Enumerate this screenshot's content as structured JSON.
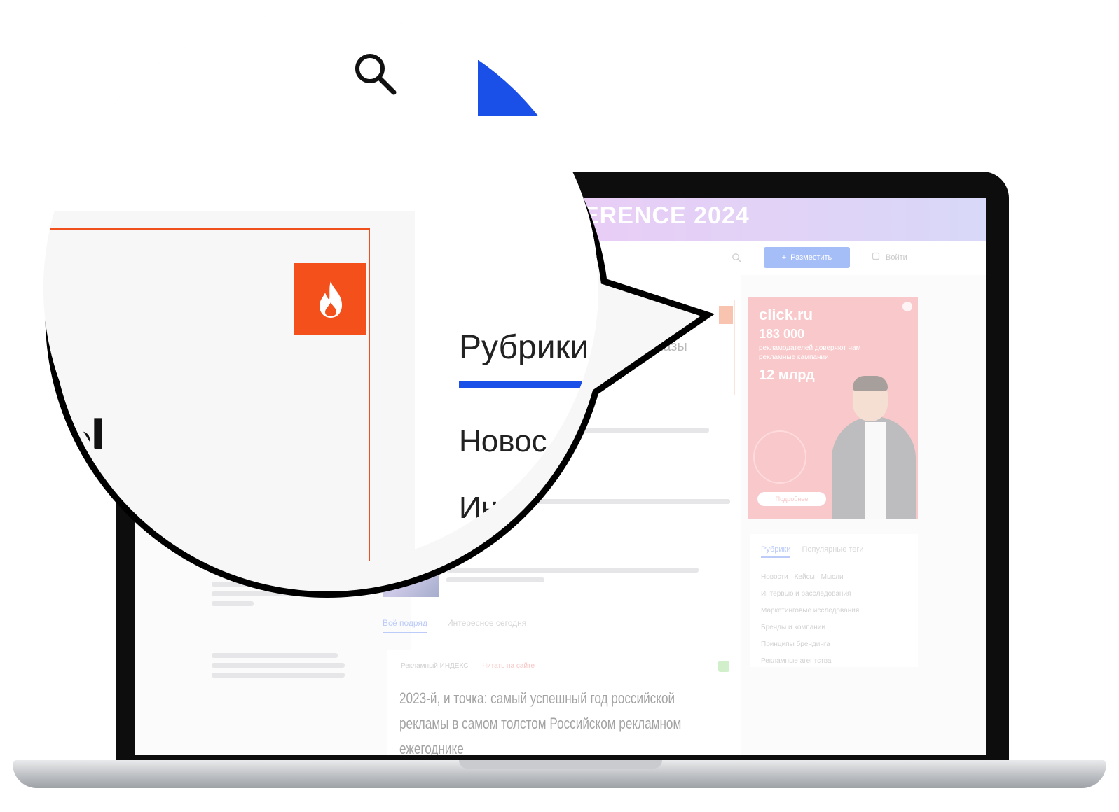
{
  "site": {
    "banner_text": "ERENCE 2024",
    "nav_button_label": "Разместить",
    "nav_login_label": "Войти"
  },
  "feature_card": {
    "title_fragment": "атега отказы"
  },
  "tabs": [
    "Всё подряд",
    "Интересное сегодня"
  ],
  "article": {
    "meta_source": "Рекламный ИНДЕКС",
    "meta_tag": "Читать на сайте",
    "title": "2023-й, и точка: самый успешный год российской рекламы в самом толстом Российском рекламном ежегоднике"
  },
  "ad": {
    "brand": "click.ru",
    "number": "183 000",
    "subtitle": "рекламодателей доверяют нам рекламные кампании",
    "amount": "12 млрд",
    "cta": "Подробнее"
  },
  "rubrics_panel": {
    "tab_active": "Рубрики",
    "tab_inactive": "Популярные теги",
    "items": [
      "Новости · Кейсы · Мысли",
      "Интервью и расследования",
      "Маркетинговые исследования",
      "Бренды и компании",
      "Принципы брендинга",
      "Рекламные агентства"
    ]
  },
  "magnifier": {
    "heading": "Рубрики",
    "item1": "Новос",
    "item2": "Ин",
    "big_letter": "ы"
  },
  "colors": {
    "accent_blue": "#1a4fe8",
    "accent_orange": "#f3501b",
    "ad_pink": "#f0868a"
  }
}
